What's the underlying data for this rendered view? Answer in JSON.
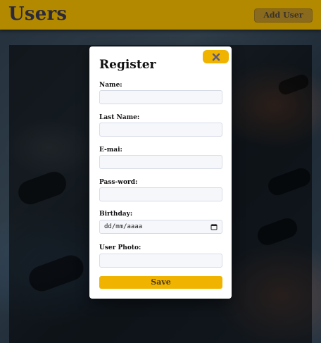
{
  "header": {
    "title": "Users",
    "add_user_label": "Add User"
  },
  "modal": {
    "title": "Register",
    "close_icon": "close-icon",
    "fields": [
      {
        "label": "Name:",
        "value": "",
        "placeholder": ""
      },
      {
        "label": "Last Name:",
        "value": "",
        "placeholder": ""
      },
      {
        "label": "E-mai:",
        "value": "",
        "placeholder": ""
      },
      {
        "label": "Pass-word:",
        "value": "",
        "placeholder": ""
      },
      {
        "label": "Birthday:",
        "value": "dd/mm/aaaa",
        "icon": "calendar-icon"
      },
      {
        "label": "User Photo:",
        "value": "",
        "placeholder": ""
      }
    ],
    "save_label": "Save"
  },
  "colors": {
    "header_bg": "#b38900",
    "accent": "#f0b400"
  }
}
